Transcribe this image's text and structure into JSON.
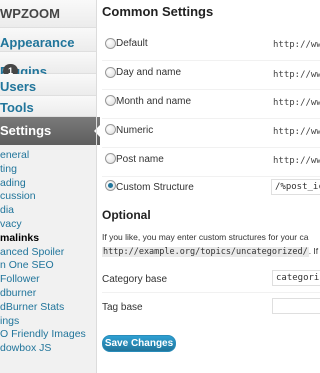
{
  "sidebar": {
    "menu": [
      {
        "label": "WPZOOM"
      },
      {
        "label": "Appearance"
      },
      {
        "label": "Plugins",
        "badge": "1"
      },
      {
        "label": "Users"
      },
      {
        "label": "Tools"
      }
    ],
    "active": {
      "label": "Settings"
    },
    "submenu": [
      "eneral",
      "ting",
      "ading",
      "cussion",
      "dia",
      "vacy",
      "malinks",
      "anced Spoiler",
      "n One SEO",
      "Follower",
      "dburner",
      "dBurner Stats",
      "ings",
      "O Friendly Images",
      "dowbox JS"
    ],
    "current_index": 6
  },
  "main": {
    "common_heading": "Common Settings",
    "options": [
      {
        "label": "Default",
        "url": "http://ww"
      },
      {
        "label": "Day and name",
        "url": "http://ww"
      },
      {
        "label": "Month and name",
        "url": "http://ww"
      },
      {
        "label": "Numeric",
        "url": "http://ww"
      },
      {
        "label": "Post name",
        "url": "http://ww"
      },
      {
        "label": "Custom Structure",
        "value": "/%post_ic",
        "checked": true
      }
    ],
    "optional_heading": "Optional",
    "optional_text_1": "If you like, you may enter custom structures for your ca",
    "optional_code": "http://example.org/topics/uncategorized/",
    "optional_text_2": ". If",
    "category_label": "Category base",
    "category_value": "categori",
    "tag_label": "Tag base",
    "tag_value": "",
    "save_label": "Save Changes"
  }
}
